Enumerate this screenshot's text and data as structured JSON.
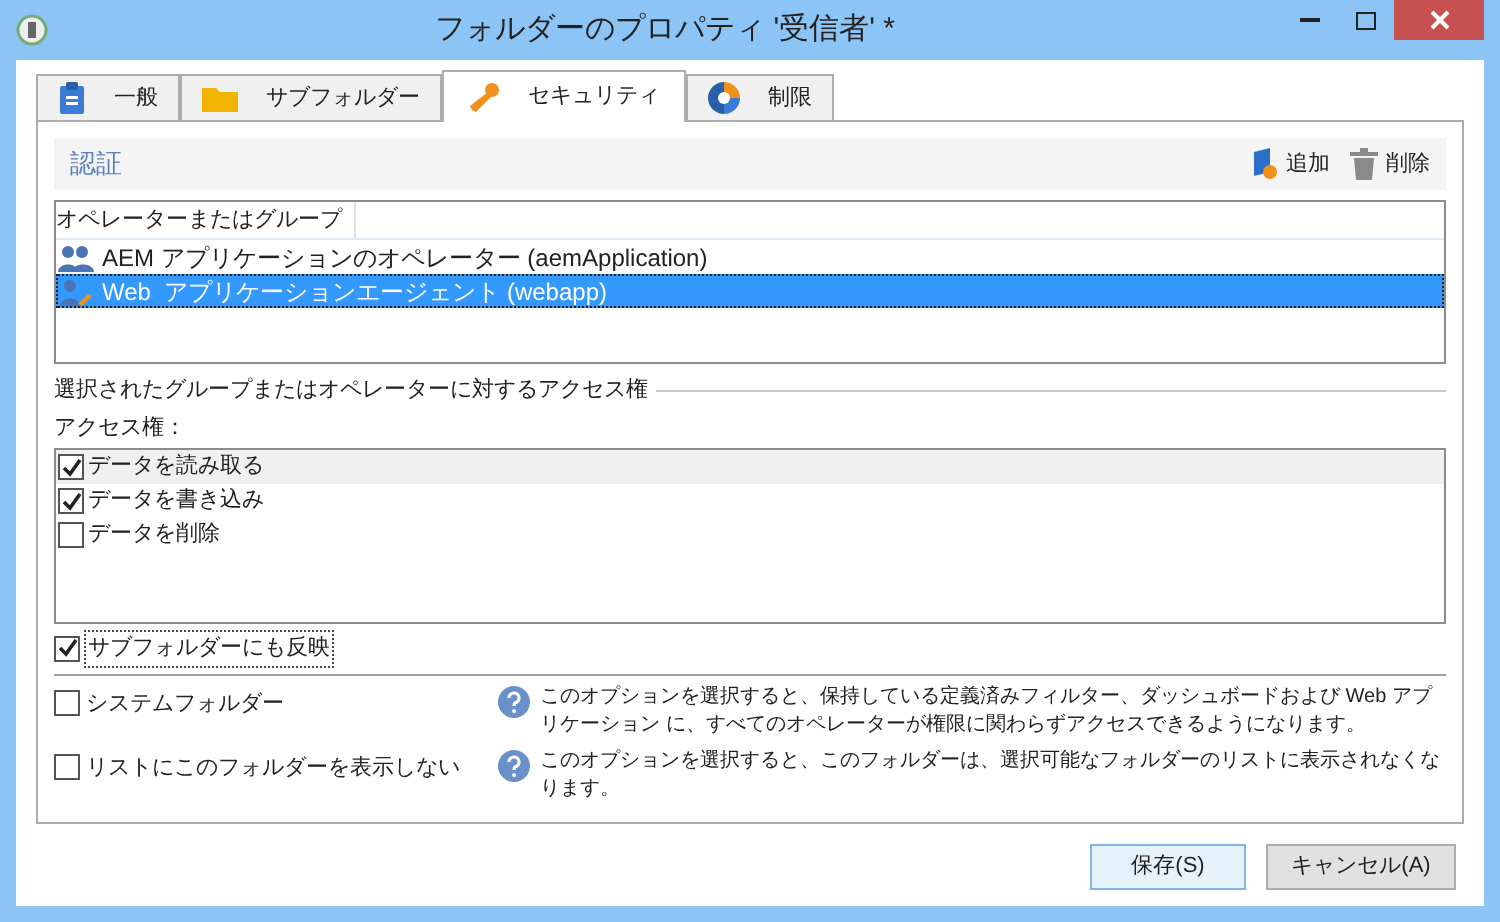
{
  "window": {
    "title": "フォルダーのプロパティ '受信者' *"
  },
  "tabs": [
    {
      "label": "一般",
      "kind": "clipboard",
      "selected": false
    },
    {
      "label": "サブフォルダー",
      "kind": "folder",
      "selected": false
    },
    {
      "label": "セキュリティ",
      "kind": "key",
      "selected": true
    },
    {
      "label": "制限",
      "kind": "chart",
      "selected": false
    }
  ],
  "auth": {
    "title": "認証",
    "actions": [
      {
        "label": "追加",
        "kind": "add"
      },
      {
        "label": "削除",
        "kind": "trash"
      }
    ]
  },
  "table": {
    "columns": [
      "オペレーターまたはグループ"
    ],
    "rows": [
      {
        "kind": "group",
        "name": "AEM アプリケーションのオペレーター (aemApplication)",
        "selected": false
      },
      {
        "kind": "agent",
        "name": "Web  アプリケーションエージェント (webapp)",
        "selected": true
      }
    ]
  },
  "access": {
    "section_title": "選択されたグループまたはオペレーターに対するアクセス権",
    "label": "アクセス権：",
    "items": [
      {
        "label": "データを読み取る",
        "checked": true,
        "selected": true
      },
      {
        "label": "データを書き込み",
        "checked": true,
        "selected": false
      },
      {
        "label": "データを削除",
        "checked": false,
        "selected": false
      }
    ]
  },
  "propagate": {
    "label": "サブフォルダーにも反映",
    "checked": true
  },
  "options": [
    {
      "label": "システムフォルダー",
      "checked": false,
      "help": "このオプションを選択すると、保持している定義済みフィルター、ダッシュボードおよび Web アプリケーション に、すべてのオペレーターが権限に関わらずアクセスできるようになります。"
    },
    {
      "label": "リストにこのフォルダーを表示しない",
      "checked": false,
      "help": "このオプションを選択すると、このフォルダーは、選択可能なフォルダーのリストに表示されなくなります。"
    }
  ],
  "buttons": [
    {
      "label": "保存(S)",
      "default": true
    },
    {
      "label": "キャンセル(A)",
      "default": false
    }
  ]
}
